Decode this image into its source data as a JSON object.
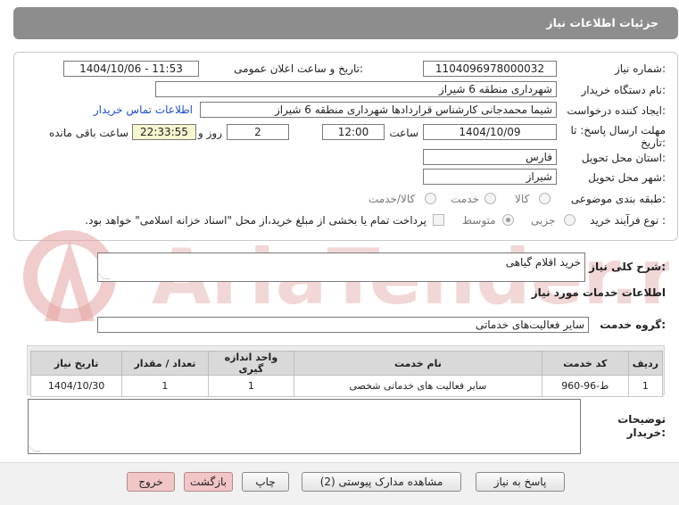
{
  "header": {
    "title": "جزئیات اطلاعات نیاز"
  },
  "fields": {
    "need_number_label": "شماره نیاز:",
    "need_number": "1104096978000032",
    "announce_label": "تاریخ و ساعت اعلان عمومی:",
    "announce_value": "1404/10/06 - 11:53",
    "buyer_org_label": "نام دستگاه خریدار:",
    "buyer_org": "شهرداری منطقه 6 شیراز",
    "requester_label": "ایجاد کننده درخواست:",
    "requester": "شیما محمدجانی کارشناس قراردادها شهرداری منطقه 6 شیراز",
    "buyer_contact_link": "اطلاعات تماس خریدار",
    "deadline_label_1": "مهلت ارسال پاسخ: تا",
    "deadline_label_2": "تاریخ:",
    "deadline_date": "1404/10/09",
    "time_label": "ساعت",
    "deadline_time": "12:00",
    "days_value": "2",
    "days_label": "روز و",
    "remaining_time": "22:33:55",
    "remaining_label": "ساعت باقی مانده",
    "province_label": "استان محل تحویل:",
    "province": "فارس",
    "city_label": "شهر محل تحویل:",
    "city": "شیراز",
    "category_label": "طبقه بندی موضوعی:",
    "category_options": [
      "کالا",
      "خدمت",
      "کالا/خدمت"
    ],
    "process_label": "نوع فرآیند خرید :",
    "process_options": [
      "جزیی",
      "متوسط"
    ],
    "payment_note": "پرداخت تمام یا بخشی از مبلغ خرید،از محل \"اسناد خزانه اسلامی\" خواهد بود."
  },
  "description": {
    "label": "شرح کلی نیاز:",
    "value": "خرید اقلام  گیاهی"
  },
  "services": {
    "section_title": "اطلاعات خدمات مورد نیاز",
    "group_label": "گروه خدمت:",
    "group_value": "سایر فعالیت‌های خدماتی",
    "columns": [
      "ردیف",
      "کد خدمت",
      "نام خدمت",
      "واحد اندازه گیری",
      "تعداد / مقدار",
      "تاریخ نیاز"
    ],
    "rows": [
      [
        "1",
        "ط-96-960",
        "سایر فعالیت های خدماتی شخصی",
        "1",
        "1",
        "1404/10/30"
      ]
    ]
  },
  "buyer_notes": {
    "label_1": "توضیحات",
    "label_2": "خریدار:",
    "value": ""
  },
  "buttons": {
    "reply": "پاسخ به نیاز",
    "attachments": "مشاهده مدارک پیوستی (2)",
    "print": "چاپ",
    "back": "بازگشت",
    "exit": "خروج"
  },
  "watermark": {
    "text": "AriaTender.neT"
  },
  "colors": {
    "header_bg": "#8d8d8d",
    "link": "#1a4fcc",
    "remaining_bg": "#f6f6cf",
    "button_pink": "#f2c6c6",
    "watermark": "#e3a3a3"
  }
}
